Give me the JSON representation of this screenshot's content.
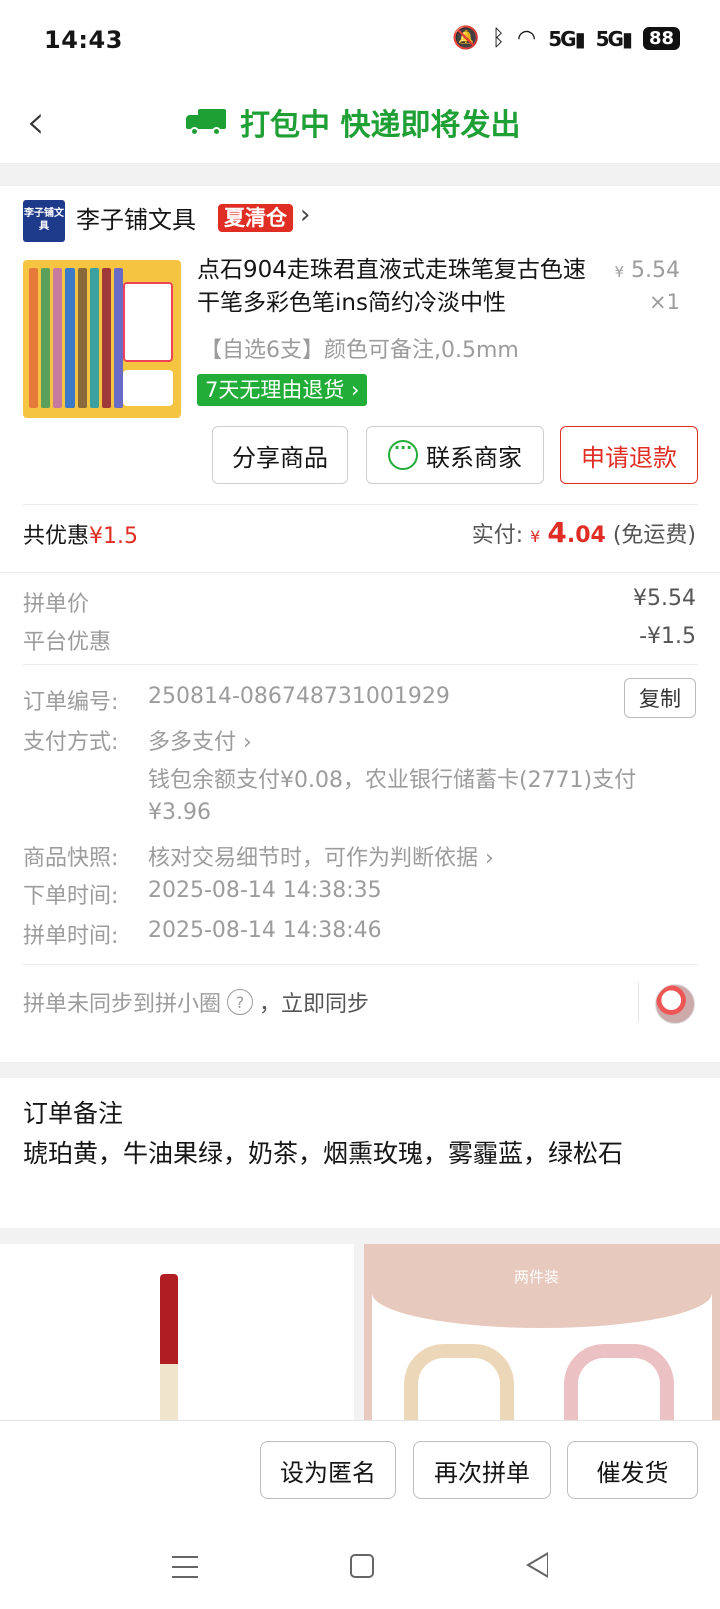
{
  "status_bar": {
    "time": "14:43",
    "battery": "88",
    "signal1": "5G",
    "signal2": "5G"
  },
  "header": {
    "title": "打包中 快递即将发出"
  },
  "shop": {
    "logo_text": "李子铺文具",
    "name": "李子铺文具",
    "tag": "夏清仓"
  },
  "product": {
    "title": "点石904走珠君直液式走珠笔复古色速干笔多彩色笔ins简约冷淡中性",
    "spec": "【自选6支】颜色可备注,0.5mm",
    "return_tag": "7天无理由退货",
    "price_symbol": "¥",
    "price": "5.54",
    "quantity": "×1"
  },
  "actions": {
    "share": "分享商品",
    "contact": "联系商家",
    "refund": "申请退款"
  },
  "summary": {
    "discount_label": "共优惠",
    "discount_value": "¥1.5",
    "paid_label": "实付:",
    "paid_symbol": "¥",
    "paid_int": "4",
    "paid_dec": ".04",
    "shipping_note": "(免运费)"
  },
  "price_breakdown": [
    {
      "label": "拼单价",
      "value": "¥5.54"
    },
    {
      "label": "平台优惠",
      "value": "-¥1.5"
    }
  ],
  "order_info": {
    "number_label": "订单编号:",
    "number": "250814-086748731001929",
    "copy": "复制",
    "pay_label": "支付方式:",
    "pay_method": "多多支付",
    "pay_detail_1": "钱包余额支付¥0.08，农业银行储蓄卡(2771)支付",
    "pay_detail_2": "¥3.96",
    "snapshot_label": "商品快照:",
    "snapshot": "核对交易细节时，可作为判断依据",
    "order_time_label": "下单时间:",
    "order_time": "2025-08-14 14:38:35",
    "group_time_label": "拼单时间:",
    "group_time": "2025-08-14 14:38:46"
  },
  "sync": {
    "text": "拼单未同步到拼小圈",
    "help": "?",
    "action": "，立即同步"
  },
  "remark": {
    "title": "订单备注",
    "text": "琥珀黄，牛油果绿，奶茶，烟熏玫瑰，雾霾蓝，绿松石"
  },
  "recommend": {
    "right_label": "两件装"
  },
  "bottom_actions": {
    "anonymous": "设为匿名",
    "regroup": "再次拼单",
    "urge": "催发货"
  },
  "colors": {
    "green": "#1ea034",
    "red": "#e02e24",
    "gray": "#9c9c9c"
  }
}
